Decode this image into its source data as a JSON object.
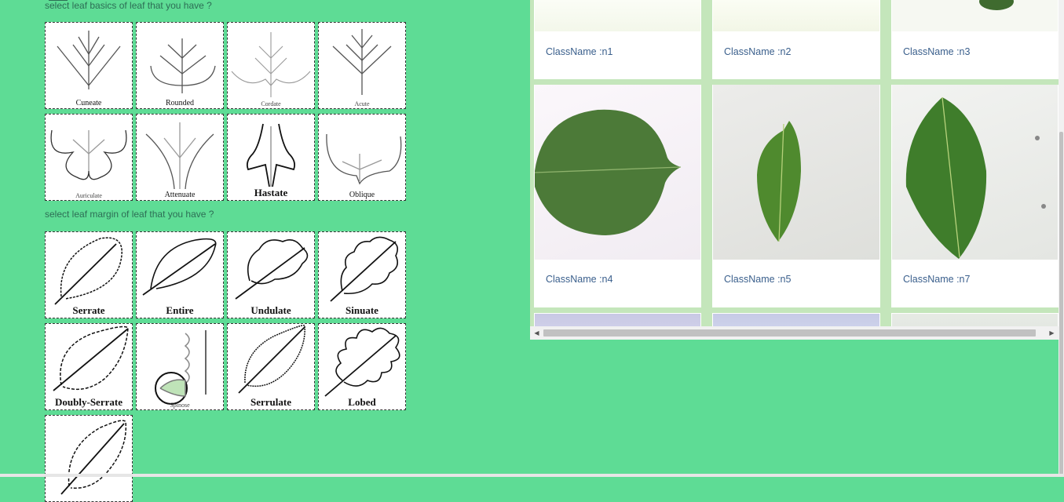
{
  "basics": {
    "question": "select leaf basics of leaf that you have ?",
    "options": [
      {
        "label": "Cuneate",
        "icon": "cuneate-base-icon"
      },
      {
        "label": "Rounded",
        "icon": "rounded-base-icon"
      },
      {
        "label": "Cordate",
        "icon": "cordate-base-icon"
      },
      {
        "label": "Acute",
        "icon": "acute-base-icon"
      },
      {
        "label": "Auriculate",
        "icon": "auriculate-base-icon"
      },
      {
        "label": "Attenuate",
        "icon": "attenuate-base-icon"
      },
      {
        "label": "Hastate",
        "icon": "hastate-base-icon"
      },
      {
        "label": "Oblique",
        "icon": "oblique-base-icon"
      }
    ]
  },
  "margin": {
    "question": "select leaf margin of leaf that you have ?",
    "options": [
      {
        "label": "Serrate",
        "icon": "serrate-margin-icon"
      },
      {
        "label": "Entire",
        "icon": "entire-margin-icon"
      },
      {
        "label": "Undulate",
        "icon": "undulate-margin-icon"
      },
      {
        "label": "Sinuate",
        "icon": "sinuate-margin-icon"
      },
      {
        "label": "Doubly-Serrate",
        "icon": "doubly-serrate-margin-icon"
      },
      {
        "label": "Spinose",
        "icon": "spinose-margin-icon"
      },
      {
        "label": "Serrulate",
        "icon": "serrulate-margin-icon"
      },
      {
        "label": "Lobed",
        "icon": "lobed-margin-icon"
      },
      {
        "label": "",
        "icon": "leaf-margin-icon"
      }
    ]
  },
  "gallery": {
    "cards": [
      {
        "name": "ClassName :n1"
      },
      {
        "name": "ClassName :n2"
      },
      {
        "name": "ClassName :n3"
      },
      {
        "name": "ClassName :n4"
      },
      {
        "name": "ClassName :n5"
      },
      {
        "name": "ClassName :n7"
      }
    ],
    "leaf_color": "#4e7d3a",
    "name_color": "#3a5f8c"
  },
  "colors": {
    "background": "#5edc95",
    "gallery_bg": "#c4e6bb"
  }
}
